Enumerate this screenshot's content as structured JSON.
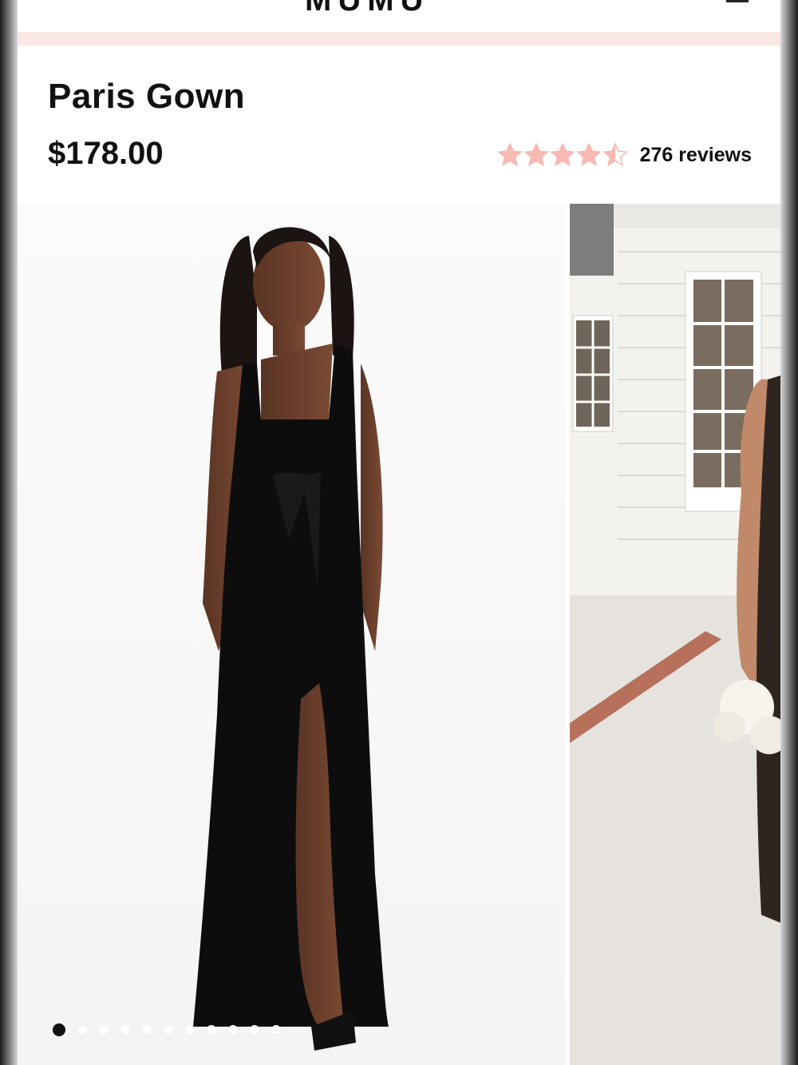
{
  "header": {
    "logo_text": "MUMU"
  },
  "product": {
    "title": "Paris Gown",
    "price": "$178.00",
    "rating": 4.5,
    "rating_max": 5,
    "reviews_label": "276 reviews"
  },
  "gallery": {
    "slide_count": 11,
    "active_index": 0
  },
  "colors": {
    "accent_pink": "#fbe7e4",
    "star_color": "#f7b9b2",
    "text": "#111111"
  },
  "icons": [
    "menu-icon",
    "star-icon",
    "star-half-icon"
  ]
}
